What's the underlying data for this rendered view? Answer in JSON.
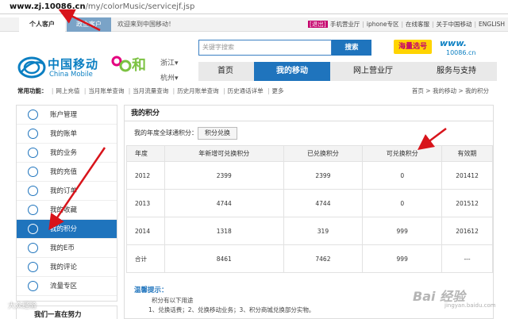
{
  "browser": {
    "url_host": "www.zj.10086.cn",
    "url_path": "/my/colorMusic/servicejf.jsp"
  },
  "topbar": {
    "tab_personal": "个人客户",
    "tab_enterprise": "政企客户",
    "welcome": "欢迎来到中国移动！",
    "logout": "[退出]",
    "links": [
      "手机营业厅",
      "iphone专区",
      "在线客服",
      "关于中国移动",
      "ENGLISH"
    ]
  },
  "brand": {
    "name_cn": "中国移动",
    "name_en": "China Mobile",
    "sub_brand": "和",
    "province": "浙江",
    "city": "杭州",
    "site_logo": "www.",
    "site_logo_sub": "10086.cn",
    "badge": "海量选号"
  },
  "search": {
    "placeholder": "关键字搜索",
    "button": "搜索"
  },
  "mainnav": [
    "首页",
    "我的移动",
    "网上营业厅",
    "服务与支持"
  ],
  "funcbar": {
    "label": "常用功能：",
    "items": [
      "网上充值",
      "当月账单查询",
      "当月流量查询",
      "历史月账单查询",
      "历史通话详单",
      "更多"
    ],
    "breadcrumb": "首页 > 我的移动 > 我的积分"
  },
  "sidebar": {
    "items": [
      "账户管理",
      "我的账单",
      "我的业务",
      "我的充值",
      "我的订单",
      "我的收藏",
      "我的积分",
      "我的E币",
      "我的评论",
      "流量专区"
    ],
    "active_index": 6,
    "next_section": "我们一直在努力"
  },
  "content": {
    "title": "我的积分",
    "total_label": "我的年度全球通积分：",
    "redeem_button": "积分兑换",
    "table": {
      "headers": [
        "年度",
        "年新增可兑换积分",
        "已兑换积分",
        "可兑换积分",
        "有效期"
      ],
      "rows": [
        [
          "2012",
          "2399",
          "2399",
          "0",
          "201412"
        ],
        [
          "2013",
          "4744",
          "4744",
          "0",
          "201512"
        ],
        [
          "2014",
          "1318",
          "319",
          "999",
          "201612"
        ],
        [
          "合计",
          "8461",
          "7462",
          "999",
          "---"
        ]
      ]
    },
    "tips_title": "温馨提示：",
    "tips_line1": "积分有以下用途",
    "tips_line2": "1、兑换话费；2、兑换移动业务；3、积分商城兑换部分实物。"
  },
  "watermarks": {
    "left": "大众经验",
    "right": "Bai 经验",
    "right_sub": "jingyan.baidu.com"
  },
  "colors": {
    "brand_blue": "#1f74bd",
    "annotation_red": "#d8141b",
    "brand_pink": "#e4007f"
  }
}
